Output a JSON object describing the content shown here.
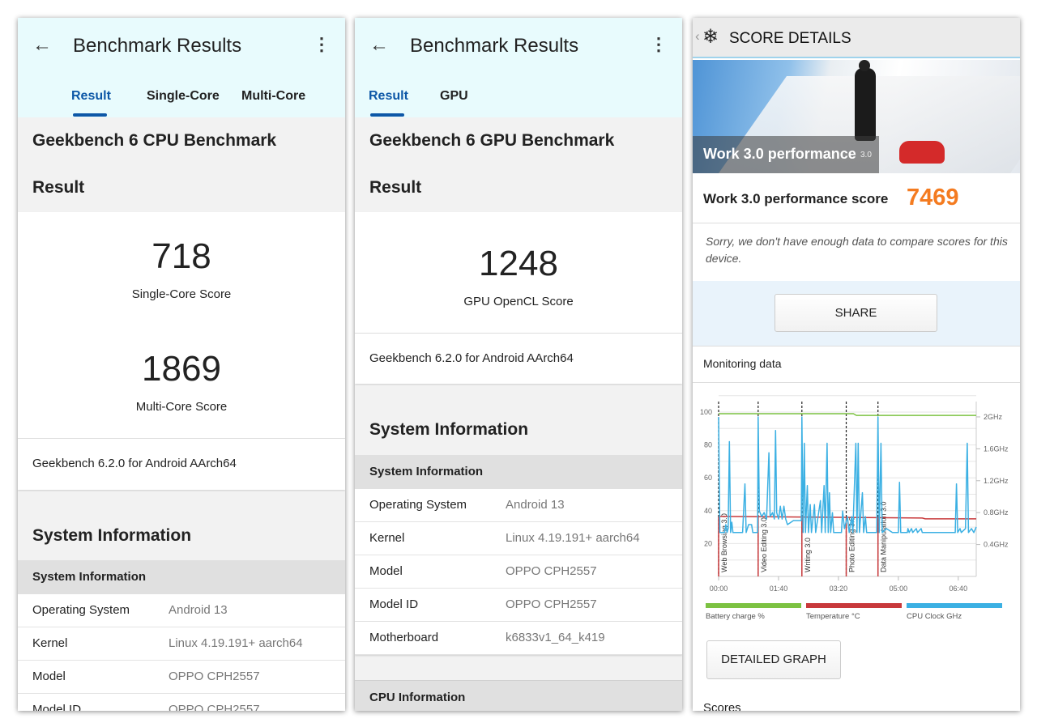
{
  "cpu_panel": {
    "title": "Benchmark Results",
    "tabs": [
      "Result",
      "Single-Core",
      "Multi-Core"
    ],
    "benchmark_name": "Geekbench 6 CPU Benchmark",
    "result_heading": "Result",
    "single_core_score": "718",
    "single_core_label": "Single-Core Score",
    "multi_core_score": "1869",
    "multi_core_label": "Multi-Core Score",
    "version": "Geekbench 6.2.0 for Android AArch64",
    "system_info_title": "System Information",
    "system_info_header": "System Information",
    "rows": [
      {
        "key": "Operating System",
        "value": "Android 13"
      },
      {
        "key": "Kernel",
        "value": "Linux 4.19.191+ aarch64"
      },
      {
        "key": "Model",
        "value": "OPPO CPH2557"
      },
      {
        "key": "Model ID",
        "value": "OPPO CPH2557"
      }
    ]
  },
  "gpu_panel": {
    "title": "Benchmark Results",
    "tabs": [
      "Result",
      "GPU"
    ],
    "benchmark_name": "Geekbench 6 GPU Benchmark",
    "result_heading": "Result",
    "score": "1248",
    "score_label": "GPU OpenCL Score",
    "version": "Geekbench 6.2.0 for Android AArch64",
    "system_info_title": "System Information",
    "system_info_header": "System Information",
    "rows": [
      {
        "key": "Operating System",
        "value": "Android 13"
      },
      {
        "key": "Kernel",
        "value": "Linux 4.19.191+ aarch64"
      },
      {
        "key": "Model",
        "value": "OPPO CPH2557"
      },
      {
        "key": "Model ID",
        "value": "OPPO CPH2557"
      },
      {
        "key": "Motherboard",
        "value": "k6833v1_64_k419"
      }
    ],
    "cpu_info_header": "CPU Information"
  },
  "pcmark_panel": {
    "header_title": "SCORE DETAILS",
    "banner_title": "Work 3.0 performance",
    "banner_badge": "3.0",
    "score_label": "Work 3.0 performance score",
    "score": "7469",
    "score_color": "#f47b20",
    "note": "Sorry, we don't have enough data to compare scores for this device.",
    "share_label": "SHARE",
    "monitoring_title": "Monitoring data",
    "detailed_graph_label": "DETAILED GRAPH",
    "scores_heading": "Scores"
  },
  "chart_data": {
    "type": "line",
    "x_ticks": [
      "00:00",
      "01:40",
      "03:20",
      "05:00",
      "06:40"
    ],
    "y_left_ticks": [
      "20",
      "40",
      "60",
      "80",
      "100"
    ],
    "y_right_ticks": [
      "0.4GHz",
      "0.8GHz",
      "1.2GHz",
      "1.6GHz",
      "2GHz"
    ],
    "xlim": [
      "00:00",
      "07:10"
    ],
    "ylim_left": [
      0,
      100
    ],
    "ylim_right_ghz": [
      0,
      2.03
    ],
    "grid": true,
    "legend_placement": "bottom",
    "markers": [
      {
        "x": "00:00",
        "label": "Web Browsing 3.0"
      },
      {
        "x": "01:06",
        "label": "Video Editing 3.0"
      },
      {
        "x": "02:19",
        "label": "Writing 3.0"
      },
      {
        "x": "03:33",
        "label": "Photo Editing 3.0"
      },
      {
        "x": "04:26",
        "label": "Data Manipulation 3.0"
      }
    ],
    "series": [
      {
        "name": "Battery charge %",
        "color": "#7cc242",
        "axis": "left",
        "points": [
          [
            "00:00",
            99
          ],
          [
            "03:45",
            99
          ],
          [
            "03:50",
            98
          ],
          [
            "07:10",
            98
          ]
        ]
      },
      {
        "name": "Temperature °C",
        "color": "#c8393b",
        "axis": "left",
        "points": [
          [
            "00:00",
            36.5
          ],
          [
            "03:00",
            36
          ],
          [
            "05:40",
            35.5
          ],
          [
            "05:45",
            35
          ],
          [
            "07:10",
            35
          ]
        ]
      },
      {
        "name": "CPU Clock GHz",
        "color": "#3bb0e3",
        "axis": "right",
        "points": [
          [
            "00:00",
            2.0
          ],
          [
            "00:02",
            0.55
          ],
          [
            "00:10",
            0.55
          ],
          [
            "00:12",
            0.65
          ],
          [
            "00:14",
            0.55
          ],
          [
            "00:16",
            0.6
          ],
          [
            "00:18",
            1.69
          ],
          [
            "00:20",
            0.55
          ],
          [
            "00:22",
            0.68
          ],
          [
            "00:24",
            0.55
          ],
          [
            "00:40",
            0.55
          ],
          [
            "00:44",
            1.16
          ],
          [
            "00:46",
            0.55
          ],
          [
            "00:50",
            0.65
          ],
          [
            "00:55",
            0.65
          ],
          [
            "00:57",
            0.55
          ],
          [
            "01:05",
            0.55
          ],
          [
            "01:06",
            2.0
          ],
          [
            "01:08",
            0.82
          ],
          [
            "01:12",
            0.75
          ],
          [
            "01:16",
            0.8
          ],
          [
            "01:20",
            0.72
          ],
          [
            "01:24",
            1.55
          ],
          [
            "01:26",
            0.75
          ],
          [
            "01:30",
            0.8
          ],
          [
            "01:33",
            0.72
          ],
          [
            "01:35",
            1.83
          ],
          [
            "01:37",
            0.8
          ],
          [
            "01:40",
            0.72
          ],
          [
            "01:43",
            0.88
          ],
          [
            "01:46",
            0.72
          ],
          [
            "01:49",
            0.88
          ],
          [
            "01:52",
            0.72
          ],
          [
            "01:55",
            0.65
          ],
          [
            "02:05",
            0.7
          ],
          [
            "02:18",
            0.7
          ],
          [
            "02:19",
            2.0
          ],
          [
            "02:21",
            0.55
          ],
          [
            "02:23",
            1.67
          ],
          [
            "02:25",
            0.55
          ],
          [
            "02:28",
            1.14
          ],
          [
            "02:30",
            0.55
          ],
          [
            "02:33",
            0.9
          ],
          [
            "02:35",
            0.55
          ],
          [
            "02:40",
            0.9
          ],
          [
            "02:42",
            0.55
          ],
          [
            "02:50",
            0.95
          ],
          [
            "02:52",
            0.55
          ],
          [
            "02:56",
            1.14
          ],
          [
            "02:58",
            0.55
          ],
          [
            "03:01",
            1.67
          ],
          [
            "03:03",
            0.55
          ],
          [
            "03:05",
            1.05
          ],
          [
            "03:07",
            0.55
          ],
          [
            "03:10",
            0.8
          ],
          [
            "03:12",
            0.55
          ],
          [
            "03:25",
            0.55
          ],
          [
            "03:27",
            0.82
          ],
          [
            "03:30",
            0.6
          ],
          [
            "03:35",
            0.75
          ],
          [
            "03:38",
            0.55
          ],
          [
            "03:42",
            0.75
          ],
          [
            "03:44",
            0.55
          ],
          [
            "03:49",
            1.67
          ],
          [
            "03:51",
            0.55
          ],
          [
            "03:53",
            1.67
          ],
          [
            "03:55",
            0.55
          ],
          [
            "04:00",
            1.05
          ],
          [
            "04:02",
            0.55
          ],
          [
            "04:05",
            0.75
          ],
          [
            "04:07",
            0.55
          ],
          [
            "04:24",
            0.55
          ],
          [
            "04:26",
            2.0
          ],
          [
            "04:28",
            0.55
          ],
          [
            "04:31",
            1.67
          ],
          [
            "04:33",
            0.55
          ],
          [
            "04:40",
            0.6
          ],
          [
            "04:50",
            0.55
          ],
          [
            "05:00",
            0.55
          ],
          [
            "05:02",
            1.18
          ],
          [
            "05:04",
            0.55
          ],
          [
            "05:15",
            0.55
          ],
          [
            "05:16",
            0.6
          ],
          [
            "05:18",
            0.55
          ],
          [
            "05:22",
            0.6
          ],
          [
            "05:24",
            0.55
          ],
          [
            "05:30",
            0.6
          ],
          [
            "05:32",
            0.55
          ],
          [
            "05:38",
            0.6
          ],
          [
            "05:40",
            0.55
          ],
          [
            "06:35",
            0.55
          ],
          [
            "06:37",
            1.16
          ],
          [
            "06:39",
            0.55
          ],
          [
            "06:43",
            0.6
          ],
          [
            "06:45",
            0.55
          ],
          [
            "06:52",
            0.6
          ],
          [
            "06:55",
            1.67
          ],
          [
            "06:57",
            0.55
          ],
          [
            "07:02",
            0.6
          ],
          [
            "07:06",
            0.55
          ],
          [
            "07:10",
            0.62
          ]
        ]
      }
    ]
  }
}
